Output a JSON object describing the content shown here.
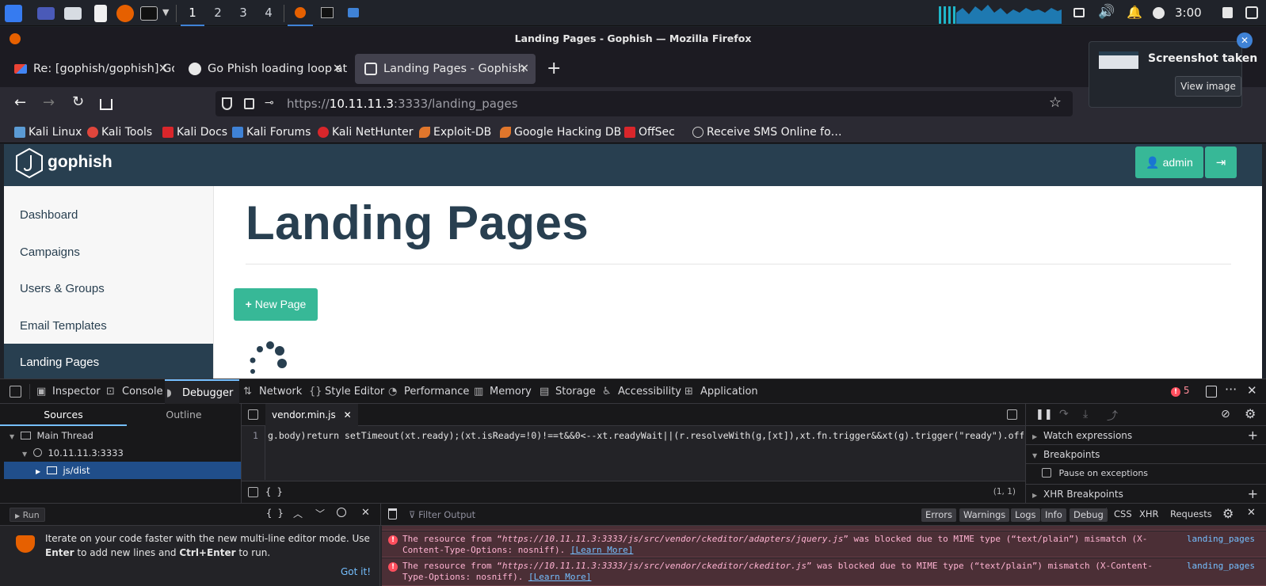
{
  "taskbar": {
    "workspaces": [
      "1",
      "2",
      "3",
      "4"
    ],
    "clock": "3:00"
  },
  "window": {
    "title": "Landing Pages - Gophish — Mozilla Firefox"
  },
  "tabs": [
    {
      "label": "Re: [gophish/gophish] Go",
      "favicon": "gmail-icon"
    },
    {
      "label": "Go Phish loading loop at l",
      "favicon": "github-icon"
    },
    {
      "label": "Landing Pages - Gophish",
      "favicon": "gophish-icon",
      "active": true
    }
  ],
  "url": {
    "prefix": "https://",
    "host": "10.11.11.3",
    "rest": ":3333/landing_pages"
  },
  "bookmarks": [
    {
      "label": "Kali Linux",
      "color": "#5b9bd5"
    },
    {
      "label": "Kali Tools",
      "color": "#e0463c"
    },
    {
      "label": "Kali Docs",
      "color": "#d9262b"
    },
    {
      "label": "Kali Forums",
      "color": "#3f82d6"
    },
    {
      "label": "Kali NetHunter",
      "color": "#d9262b"
    },
    {
      "label": "Exploit-DB",
      "color": "#e0762c"
    },
    {
      "label": "Google Hacking DB",
      "color": "#e0762c"
    },
    {
      "label": "OffSec",
      "color": "#d9262b"
    },
    {
      "label": "Receive SMS Online fo…",
      "color": "#cccccc"
    }
  ],
  "notification": {
    "title": "Screenshot taken",
    "button": "View image"
  },
  "app": {
    "brand": "gophish",
    "admin_label": "admin",
    "sidebar": [
      "Dashboard",
      "Campaigns",
      "Users & Groups",
      "Email Templates",
      "Landing Pages"
    ],
    "heading": "Landing Pages",
    "new_page_label": "New Page"
  },
  "devtools": {
    "tabs": [
      "Inspector",
      "Console",
      "Debugger",
      "Network",
      "Style Editor",
      "Performance",
      "Memory",
      "Storage",
      "Accessibility",
      "Application"
    ],
    "error_count": "5",
    "sources_tab": "Sources",
    "outline_tab": "Outline",
    "thread": "Main Thread",
    "host": "10.11.11.3:3333",
    "folder": "js/dist",
    "file_tab": "vendor.min.js",
    "line_no": "1",
    "code": "g.body)return setTimeout(xt.ready);(xt.isReady=!0)!==t&&0<--xt.readyWait||(r.resolveWith(g,[xt]),xt.fn.trigger&&xt(g).trigger(\"ready\").off(\"read",
    "cursor_pos": "(1, 1)",
    "format_label": "{ }",
    "watch": "Watch expressions",
    "breakpoints": "Breakpoints",
    "pause_exceptions": "Pause on exceptions",
    "xhr_breakpoints": "XHR Breakpoints"
  },
  "console": {
    "run_label": "Run",
    "filter_placeholder": "Filter Output",
    "filters": [
      "Errors",
      "Warnings",
      "Logs",
      "Info",
      "Debug"
    ],
    "extra_filters": [
      "CSS",
      "XHR",
      "Requests"
    ],
    "tip_pre": "Iterate on your code faster with the new multi-line editor mode. Use ",
    "tip_enter": "Enter",
    "tip_mid": " to add new lines and ",
    "tip_ctrl": "Ctrl+Enter",
    "tip_post": " to run.",
    "got_it": "Got it!",
    "errors": [
      {
        "pre": "The resource from “",
        "url": "https://10.11.11.3:3333/js/src/vendor/ckeditor/adapters/jquery.js",
        "post": "” was blocked due to MIME type (“text/plain”) mismatch (X-Content-Type-Options: nosniff).",
        "link": "[Learn More]",
        "source": "landing_pages"
      },
      {
        "pre": "The resource from “",
        "url": "https://10.11.11.3:3333/js/src/vendor/ckeditor/ckeditor.js",
        "post": "” was blocked due to MIME type (“text/plain”) mismatch (X-Content-Type-Options: nosniff).",
        "link": "[Learn More]",
        "source": "landing_pages"
      }
    ]
  }
}
